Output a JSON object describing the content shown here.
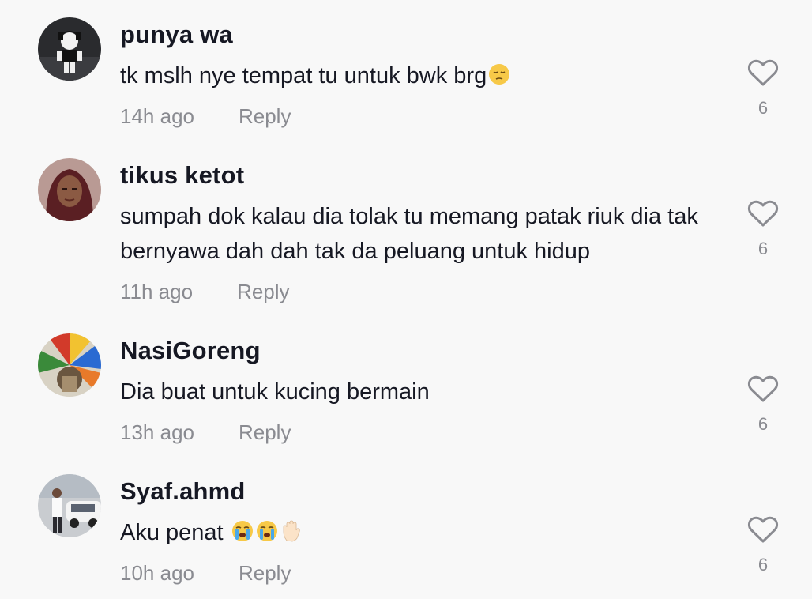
{
  "comments": [
    {
      "username": "punya wa",
      "text": "tk mslh nye tempat tu untuk bwk brg",
      "emojis": [
        "pensive-face-emoji"
      ],
      "time": "14h ago",
      "reply_label": "Reply",
      "likes": "6"
    },
    {
      "username": "tikus ketot",
      "text": "sumpah dok kalau dia tolak tu memang patak riuk dia tak bernyawa dah dah tak da peluang untuk hidup",
      "emojis": [],
      "time": "11h ago",
      "reply_label": "Reply",
      "likes": "6"
    },
    {
      "username": "NasiGoreng",
      "text": "Dia buat untuk kucing bermain",
      "emojis": [],
      "time": "13h ago",
      "reply_label": "Reply",
      "likes": "6"
    },
    {
      "username": "Syaf.ahmd",
      "text": "Aku penat ",
      "emojis": [
        "loudly-crying-face-emoji",
        "loudly-crying-face-emoji",
        "raised-hand-emoji"
      ],
      "time": "10h ago",
      "reply_label": "Reply",
      "likes": "6"
    }
  ],
  "icons": {
    "like": "heart-outline-icon"
  },
  "colors": {
    "background": "#f8f8f8",
    "primary_text": "#161823",
    "secondary_text": "#8a8b91"
  }
}
